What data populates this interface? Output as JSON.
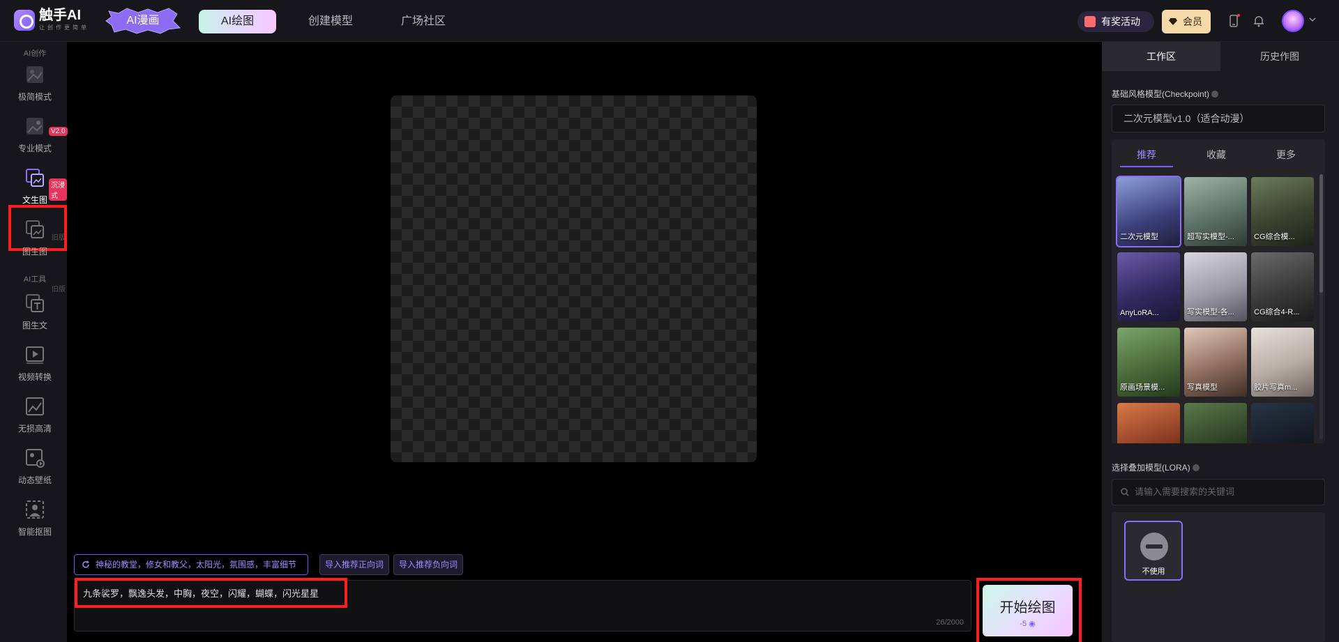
{
  "header": {
    "logo_title": "触手AI",
    "logo_sub": "让创作更简单",
    "manga_badge": "AI漫画",
    "tabs": [
      {
        "label": "AI绘图"
      },
      {
        "label": "创建模型"
      },
      {
        "label": "广场社区"
      }
    ],
    "event_label": "有奖活动",
    "vip_label": "会员"
  },
  "sidebar": {
    "section_create": "AI创作",
    "section_tools": "AI工具",
    "items": [
      {
        "label": "极简模式",
        "badge": "V2.0"
      },
      {
        "label": "专业模式",
        "badge": "沉浸式"
      },
      {
        "label": "文生图",
        "tag": "旧版"
      },
      {
        "label": "图生图",
        "tag": "旧版"
      },
      {
        "label": "图生文"
      },
      {
        "label": "视频转换"
      },
      {
        "label": "无损高清"
      },
      {
        "label": "动态壁纸"
      },
      {
        "label": "智能抠图"
      }
    ]
  },
  "prompt": {
    "suggestion": "神秘的教堂，修女和教父，太阳光，氛围感，丰富细节",
    "import_positive": "导入推荐正向词",
    "import_negative": "导入推荐负向词",
    "value": "九条裟罗，飘逸头发，中胸，夜空，闪耀，蝴蝶，闪光星星",
    "counter": "26/2000",
    "start_label": "开始绘图",
    "start_cost": "-5"
  },
  "right_panel": {
    "tabs": [
      {
        "label": "工作区"
      },
      {
        "label": "历史作图"
      }
    ],
    "checkpoint_label": "基础风格模型(Checkpoint)",
    "checkpoint_value": "二次元模型v1.0（适合动漫）",
    "model_tabs": [
      {
        "label": "推荐"
      },
      {
        "label": "收藏"
      },
      {
        "label": "更多"
      }
    ],
    "models": [
      {
        "name": "二次元模型"
      },
      {
        "name": "超写实模型-..."
      },
      {
        "name": "CG综合模..."
      },
      {
        "name": "AnyLoRA..."
      },
      {
        "name": "写实模型-各..."
      },
      {
        "name": "CG综合4-R..."
      },
      {
        "name": "原画场景模..."
      },
      {
        "name": "写真模型"
      },
      {
        "name": "胶片写真m..."
      },
      {
        "name": ""
      },
      {
        "name": ""
      },
      {
        "name": ""
      }
    ],
    "lora_label": "选择叠加模型(LORA)",
    "lora_search_placeholder": "请输入需要搜索的关键词",
    "lora_none": "不使用"
  },
  "colors": {
    "accent": "#7a5cff",
    "highlight_box": "#ff1e1e",
    "badge_red": "#e8335a"
  }
}
